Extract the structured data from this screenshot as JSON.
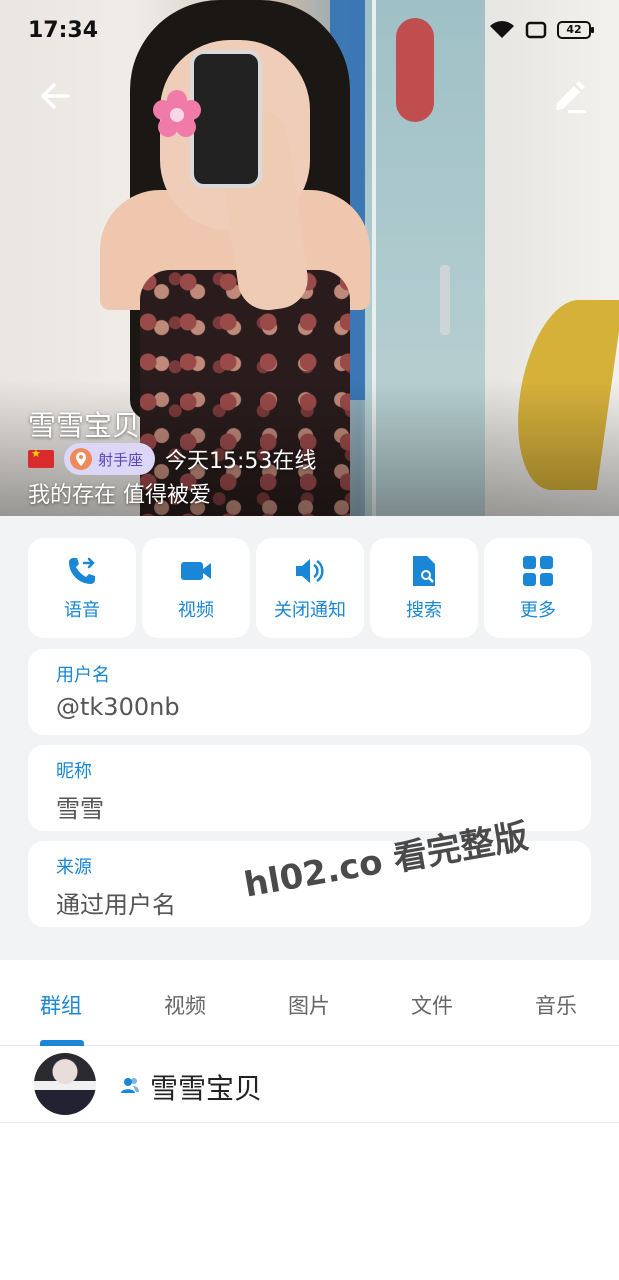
{
  "status_bar": {
    "time": "17:34",
    "battery": "42"
  },
  "profile": {
    "name": "雪雪宝贝",
    "zodiac": "射手座",
    "last_seen": "今天15:53在线",
    "bio": "我的存在 值得被爱"
  },
  "actions": [
    {
      "label": "语音",
      "icon": "phone-forward-icon"
    },
    {
      "label": "视频",
      "icon": "video-camera-icon"
    },
    {
      "label": "关闭通知",
      "icon": "speaker-icon"
    },
    {
      "label": "搜索",
      "icon": "file-search-icon"
    },
    {
      "label": "更多",
      "icon": "grid-icon"
    }
  ],
  "info": {
    "username": {
      "label": "用户名",
      "value": "@tk300nb"
    },
    "nickname": {
      "label": "昵称",
      "value": "雪雪"
    },
    "source": {
      "label": "来源",
      "value": "通过用户名"
    }
  },
  "watermark": "hl02.co 看完整版",
  "tabs": [
    "群组",
    "视频",
    "图片",
    "文件",
    "音乐"
  ],
  "active_tab": "群组",
  "groups": [
    {
      "name": "雪雪宝贝"
    }
  ],
  "colors": {
    "accent": "#1a87d6",
    "zodiac_bg": "#dcd6f7",
    "zodiac_text": "#5b45b8"
  }
}
